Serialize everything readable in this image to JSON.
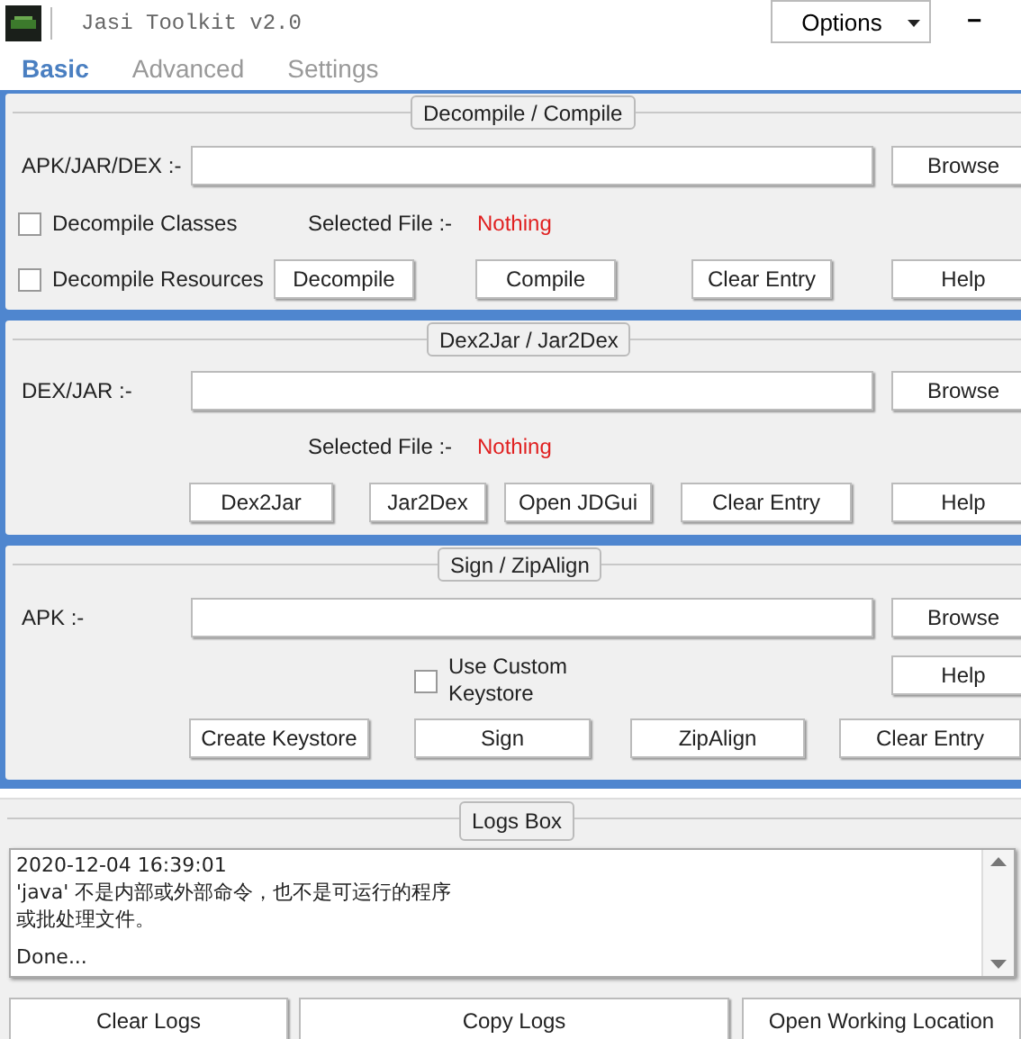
{
  "window": {
    "title": "Jasi Toolkit v2.0",
    "options": "Options",
    "minimize": "−"
  },
  "tabs": [
    {
      "label": "Basic",
      "selected": true
    },
    {
      "label": "Advanced",
      "selected": false
    },
    {
      "label": "Settings",
      "selected": false
    }
  ],
  "decompile": {
    "title": "Decompile / Compile",
    "file_label": "APK/JAR/DEX :-",
    "browse": "Browse",
    "checkboxes": [
      {
        "label": "Decompile Classes",
        "checked": false
      },
      {
        "label": "Decompile Resources",
        "checked": false
      }
    ],
    "selected_label": "Selected File :-",
    "selected_value": "Nothing",
    "buttons": [
      "Decompile",
      "Compile",
      "Clear Entry",
      "Help"
    ]
  },
  "dex2jar": {
    "title": "Dex2Jar / Jar2Dex",
    "file_label": "DEX/JAR :-",
    "browse": "Browse",
    "selected_label": "Selected File :-",
    "selected_value": "Nothing",
    "buttons": [
      "Dex2Jar",
      "Jar2Dex",
      "Open JDGui",
      "Clear Entry",
      "Help"
    ]
  },
  "sign": {
    "title": "Sign / ZipAlign",
    "file_label": "APK :-",
    "browse": "Browse",
    "checkbox": {
      "label": "Use Custom Keystore",
      "checked": false
    },
    "help": "Help",
    "buttons": [
      "Create Keystore",
      "Sign",
      "ZipAlign",
      "Clear Entry"
    ]
  },
  "logs": {
    "title": "Logs Box",
    "lines": [
      "2020-12-04 16:39:01",
      "'java' 不是内部或外部命令，也不是可运行的程序",
      "或批处理文件。",
      "Done..."
    ],
    "buttons": [
      "Clear Logs",
      "Copy Logs",
      "Open Working Location"
    ]
  }
}
